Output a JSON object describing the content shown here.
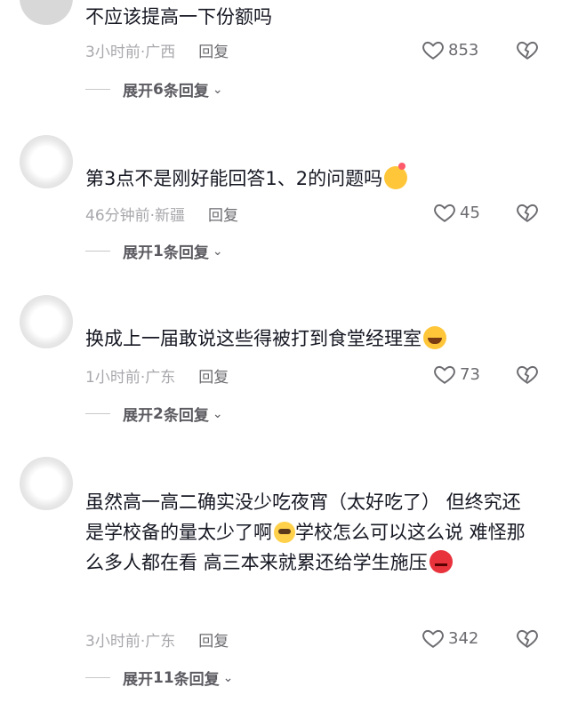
{
  "comments": [
    {
      "text": "不应该提高一下份额吗",
      "time": "3小时前",
      "location": "广西",
      "reply_label": "回复",
      "likes": "853",
      "expand": {
        "prefix": "展开",
        "count": "6",
        "suffix": "条回复"
      }
    },
    {
      "text": "第3点不是刚好能回答1、2的问题吗",
      "emoji": "shy-emoji",
      "time": "46分钟前",
      "location": "新疆",
      "reply_label": "回复",
      "likes": "45",
      "expand": {
        "prefix": "展开",
        "count": "1",
        "suffix": "条回复"
      }
    },
    {
      "text": "换成上一届敢说这些得被打到食堂经理室",
      "emoji": "laugh-cry-emoji",
      "time": "1小时前",
      "location": "广东",
      "reply_label": "回复",
      "likes": "73",
      "expand": {
        "prefix": "展开",
        "count": "2",
        "suffix": "条回复"
      }
    },
    {
      "text_part1": "虽然高一高二确实没少吃夜宵（太好吃了） 但终究还是学校备的量太少了啊",
      "text_part2": "学校怎么可以这么说 难怪那么多人都在看 高三本来就累还给学生施压",
      "emoji_mid": "pleading-emoji",
      "emoji_end": "angry-emoji",
      "time": "3小时前",
      "location": "广东",
      "reply_label": "回复",
      "likes": "342",
      "expand": {
        "prefix": "展开",
        "count": "11",
        "suffix": "条回复"
      }
    }
  ],
  "colors": {
    "text": "#161823",
    "meta": "#a8a8ad",
    "reply": "#6b6b70"
  }
}
